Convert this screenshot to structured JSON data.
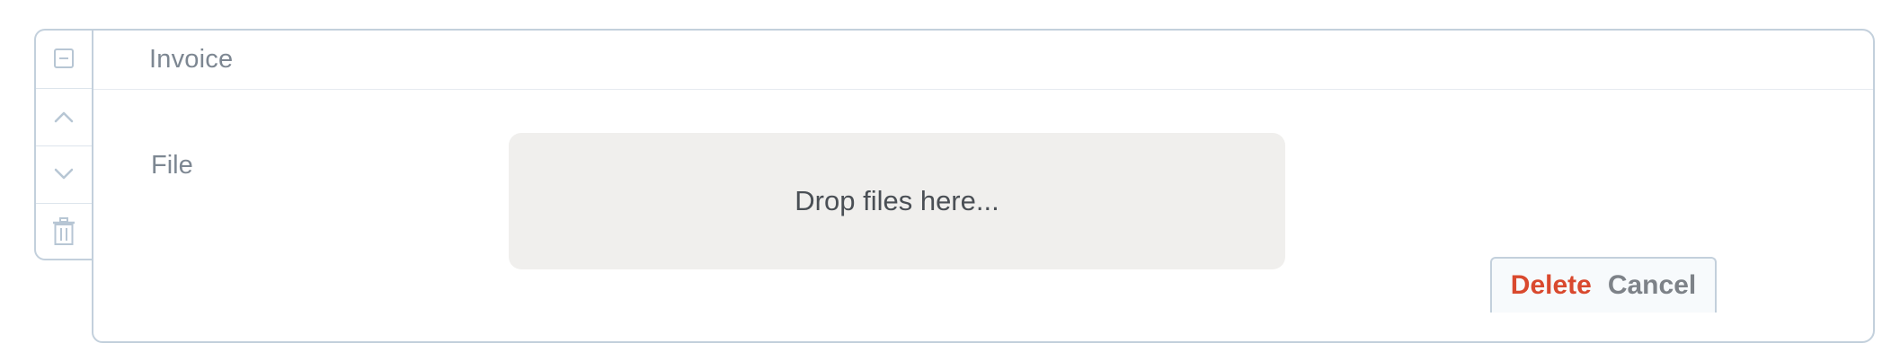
{
  "panel": {
    "title": "Invoice"
  },
  "controls": {
    "collapse_icon": "minus-square-icon",
    "move_up_icon": "chevron-up-icon",
    "move_down_icon": "chevron-down-icon",
    "delete_icon": "trash-icon"
  },
  "field": {
    "label": "File",
    "dropzone_text": "Drop files here..."
  },
  "actions": {
    "delete_label": "Delete",
    "cancel_label": "Cancel"
  },
  "colors": {
    "border": "#c3d0dc",
    "delete": "#d9492e",
    "cancel": "#7d8288",
    "dropzone_bg": "#f0efed"
  }
}
